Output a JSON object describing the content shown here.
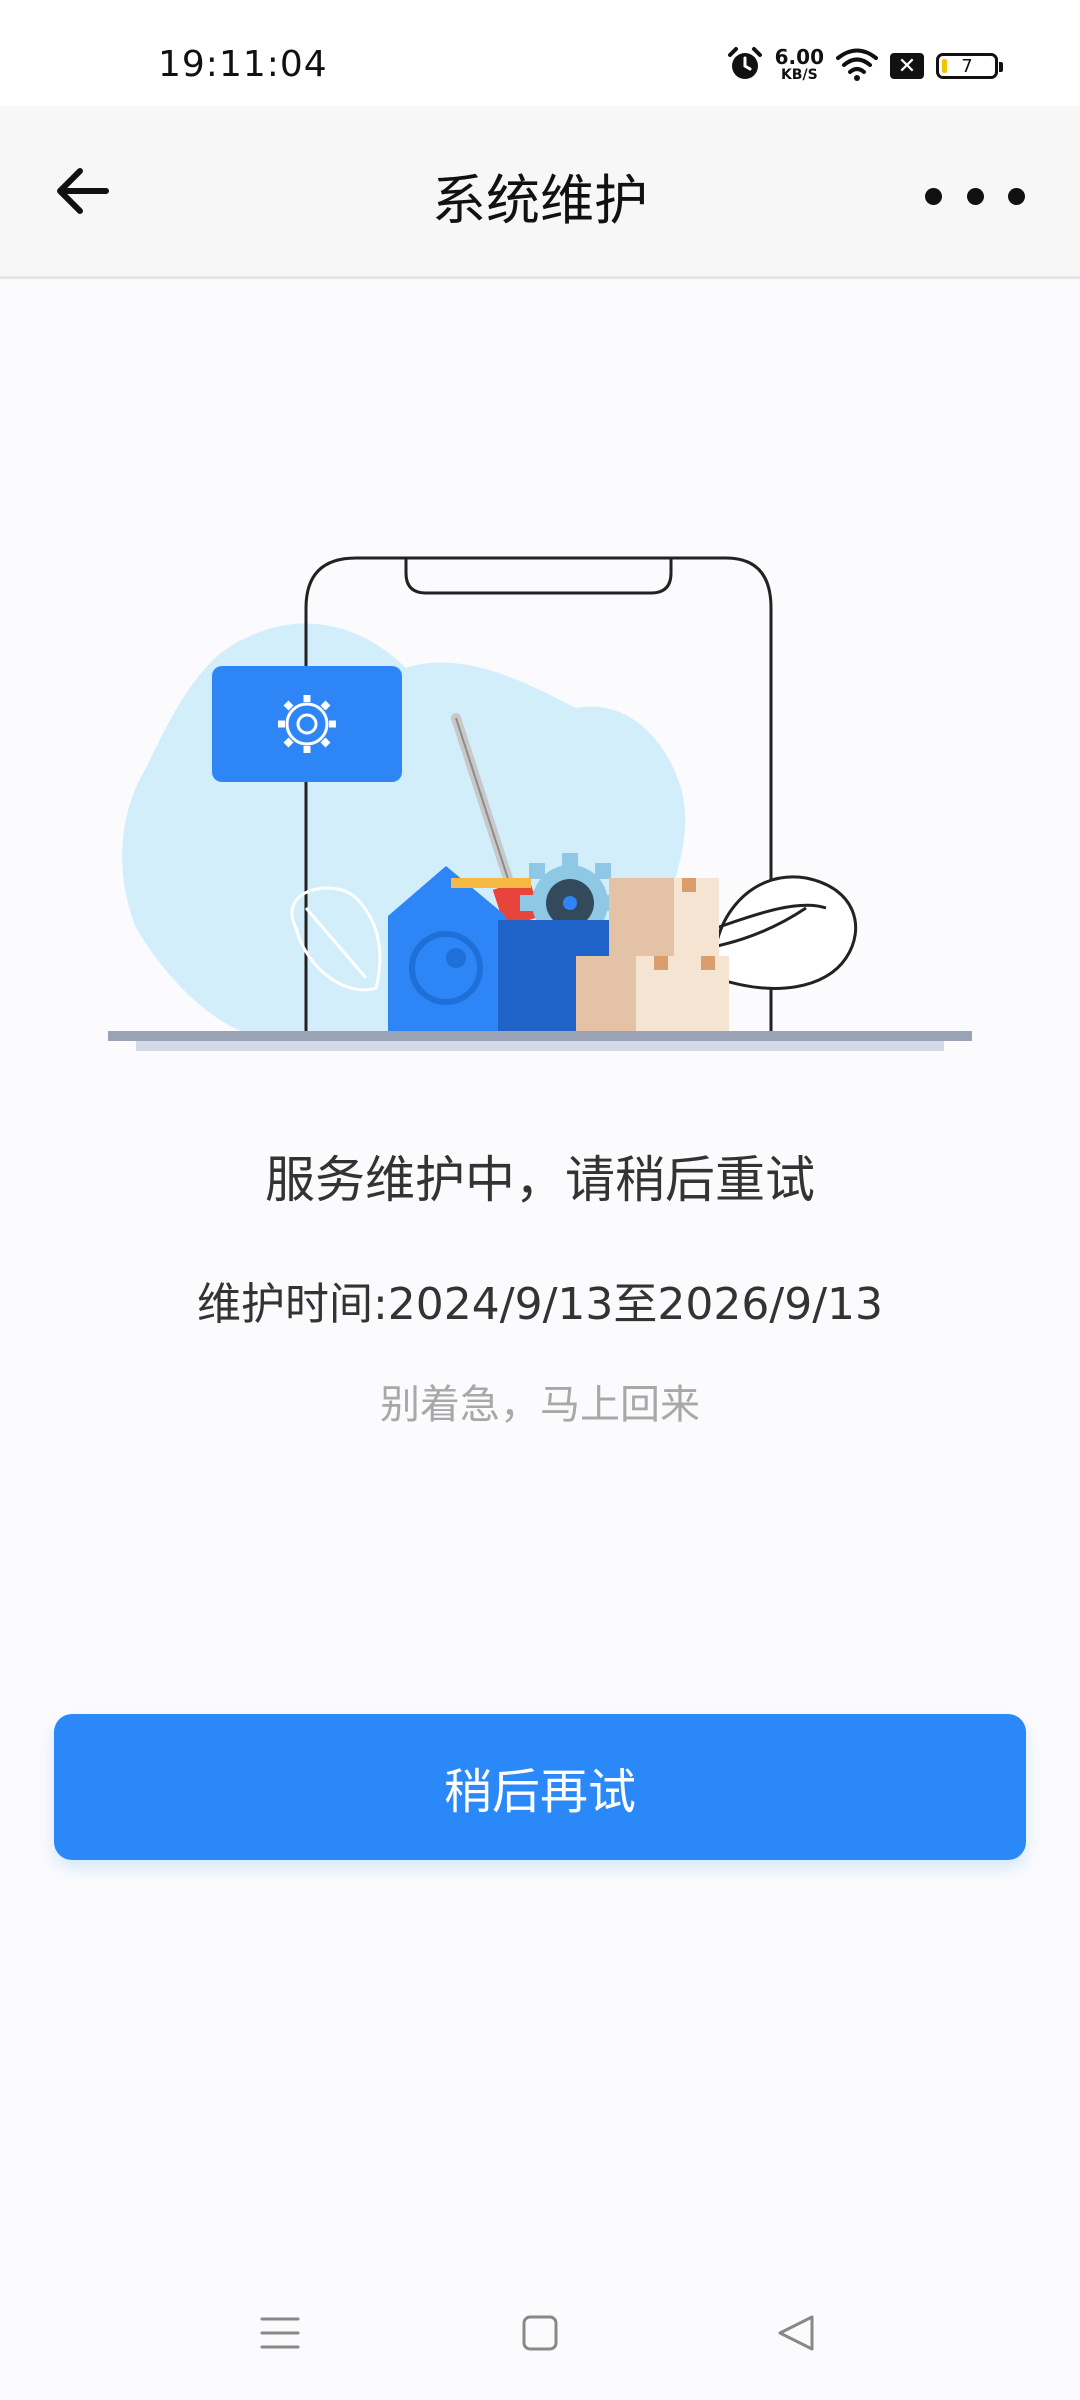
{
  "status_bar": {
    "time": "19:11:04",
    "net_speed_value": "6.00",
    "net_speed_unit": "KB/S",
    "battery_level": "7",
    "icons": [
      "alarm-icon",
      "wifi-icon",
      "sim-blocked-icon",
      "battery-icon"
    ]
  },
  "header": {
    "title": "系统维护",
    "back_icon": "arrow-left-icon",
    "more_icon": "more-dots-icon"
  },
  "content": {
    "illustration": "maintenance-toolbox-illustration",
    "message": "服务维护中，请稍后重试",
    "maintenance_time": "维护时间:2024/9/13至2026/9/13",
    "subtext": "别着急，马上回来"
  },
  "actions": {
    "retry_label": "稍后再试"
  },
  "nav_bar": {
    "icons": [
      "menu-icon",
      "home-icon",
      "back-triangle-icon"
    ]
  },
  "colors": {
    "accent": "#2b88f8",
    "title_text": "#111111",
    "sub_text": "#a8a8a8"
  }
}
